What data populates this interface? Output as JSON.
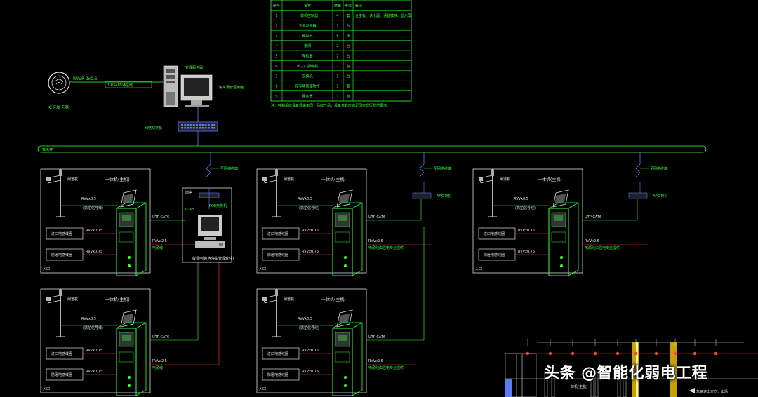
{
  "table": {
    "headers": [
      "序号",
      "名称",
      "数量",
      "单位",
      "备注"
    ],
    "rows": [
      [
        "1",
        "一体机控制器",
        "4",
        "套",
        "含主板、读卡器、语音模块、显示屏"
      ],
      [
        "2",
        "专业发卡器",
        "1",
        "台",
        ""
      ],
      [
        "3",
        "感应卡",
        "8",
        "张",
        ""
      ],
      [
        "4",
        "道闸",
        "2",
        "台",
        ""
      ],
      [
        "5",
        "车检器",
        "2",
        "台",
        ""
      ],
      [
        "6",
        "出入口摄像机",
        "2",
        "台",
        ""
      ],
      [
        "7",
        "交换机",
        "1",
        "台",
        ""
      ],
      [
        "8",
        "停车场管理软件",
        "1",
        "套",
        ""
      ],
      [
        "9",
        "服务器",
        "1",
        "台",
        ""
      ]
    ],
    "note": "注：控制系统设备须采用同一品牌产品，设备参数应满足国家现行规范要求。"
  },
  "top": {
    "ic_label": "IC卡发卡器",
    "rvvp_label": "RVVP-2x0.5",
    "rs485_label": "1 RS485通信线",
    "pc_label": "停车场管理电脑",
    "server_label": "管理服务器",
    "switch_label": "网络交换机"
  },
  "backbone_label": "TCP/IP",
  "to_terminal": "至网络终端",
  "units": {
    "title": "一体机(主机)",
    "gate_label": "闸道机",
    "rvv_label": "RVVx0.5",
    "rvv_sub": "(抓拍信号线)",
    "rvv75": "RVVx0.75",
    "loop1": "进口地感线圈",
    "loop2": "防砸地感线圈",
    "utp": "UTP-CAT6",
    "rvv_power": "RVVx2.5",
    "power": "电源线",
    "power_long": "电源线由强电专业提供",
    "corner": "入口",
    "ap_label": "AP交换机"
  },
  "booth": {
    "title": "岗亭",
    "switch_label": "POE交换机",
    "utp_label": "UTP5",
    "pc_label": "收费电脑(含停车管理软件)"
  },
  "bottom": {
    "gate_label": "一体机(主机)",
    "arrow_label": "车辆进出方向：出场"
  },
  "watermark": "头条 @智能化弱电工程"
}
